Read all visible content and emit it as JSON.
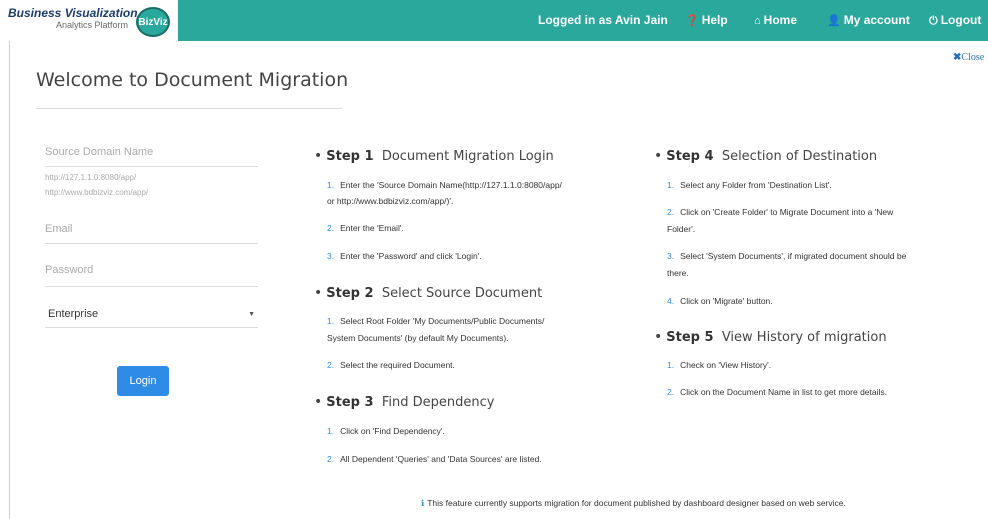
{
  "header": {
    "brand_title": "Business Visualization",
    "brand_subtitle": "Analytics Platform",
    "brand_logo": "BizViz",
    "logged_in": "Logged in as Avin Jain",
    "help": "Help",
    "home": "Home",
    "account": "My account",
    "logout": "Logout"
  },
  "dialog": {
    "title": "Welcome to Document Migration",
    "close": "Close"
  },
  "form": {
    "source_domain_label": "Source Domain Name",
    "hint1": "http://127.1.1.0:8080/app/",
    "hint2": "http://www.bdbizviz.com/app/",
    "email_label": "Email",
    "password_label": "Password",
    "select_value": "Enterprise",
    "login": "Login"
  },
  "steps": {
    "s1": {
      "num": "Step 1",
      "title": "Document Migration Login",
      "l1a": "Enter the 'Source Domain Name(http://127.1.1.0:8080/app/",
      "l1b": "or http://www.bdbizviz.com/app/)'.",
      "l2": "Enter the 'Email'.",
      "l3": "Enter the 'Password' and click 'Login'."
    },
    "s2": {
      "num": "Step 2",
      "title": "Select Source Document",
      "l1a": "Select Root Folder 'My Documents/Public Documents/",
      "l1b": "System Documents' (by default My Documents).",
      "l2": "Select the required Document."
    },
    "s3": {
      "num": "Step 3",
      "title": "Find Dependency",
      "l1": "Click on 'Find Dependency'.",
      "l2": "All Dependent 'Queries' and 'Data Sources' are listed."
    },
    "s4": {
      "num": "Step 4",
      "title": "Selection of Destination",
      "l1": "Select any Folder from 'Destination List'.",
      "l2a": "Click on 'Create Folder' to Migrate Document into a 'New",
      "l2b": "Folder'.",
      "l3a": "Select 'System Documents', if migrated document should be",
      "l3b": "there.",
      "l4": "Click on 'Migrate' button."
    },
    "s5": {
      "num": "Step 5",
      "title": "View History of migration",
      "l1": "Check on 'View History'.",
      "l2": "Click on the Document Name in list to get more details."
    }
  },
  "footer": "This feature currently supports migration for document published by dashboard designer based on web service."
}
